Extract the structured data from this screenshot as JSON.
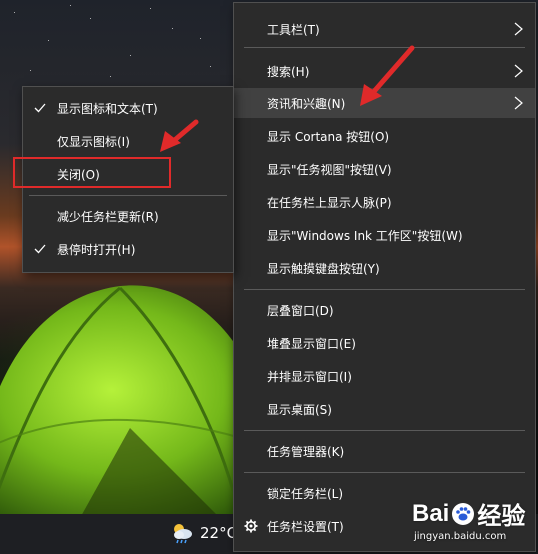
{
  "main_menu": {
    "items": [
      {
        "label": "工具栏(T)",
        "submenu": true
      },
      {
        "label": "搜索(H)",
        "submenu": true
      },
      {
        "label": "资讯和兴趣(N)",
        "submenu": true,
        "highlighted": true
      },
      {
        "label": "显示 Cortana 按钮(O)"
      },
      {
        "label": "显示\"任务视图\"按钮(V)"
      },
      {
        "label": "在任务栏上显示人脉(P)"
      },
      {
        "label": "显示\"Windows Ink 工作区\"按钮(W)"
      },
      {
        "label": "显示触摸键盘按钮(Y)"
      },
      {
        "label": "层叠窗口(D)"
      },
      {
        "label": "堆叠显示窗口(E)"
      },
      {
        "label": "并排显示窗口(I)"
      },
      {
        "label": "显示桌面(S)"
      },
      {
        "label": "任务管理器(K)"
      },
      {
        "label": "锁定任务栏(L)"
      },
      {
        "label": "任务栏设置(T)",
        "icon": "gear-icon"
      }
    ]
  },
  "sub_menu": {
    "items": [
      {
        "label": "显示图标和文本(T)",
        "checked": true
      },
      {
        "label": "仅显示图标(I)"
      },
      {
        "label": "关闭(O)",
        "boxed": true
      },
      {
        "label": "减少任务栏更新(R)"
      },
      {
        "label": "悬停时打开(H)",
        "checked": true
      }
    ]
  },
  "taskbar": {
    "weather_icon": "partly-cloudy-rain-icon",
    "temperature": "22°C"
  },
  "watermark": {
    "brand": "Bai",
    "brand_suffix": "经验",
    "url": "jingyan.baidu.com"
  },
  "colors": {
    "menu_bg": "#2b2b2b",
    "menu_highlight": "#414141",
    "annotation_red": "#e02a2a"
  }
}
